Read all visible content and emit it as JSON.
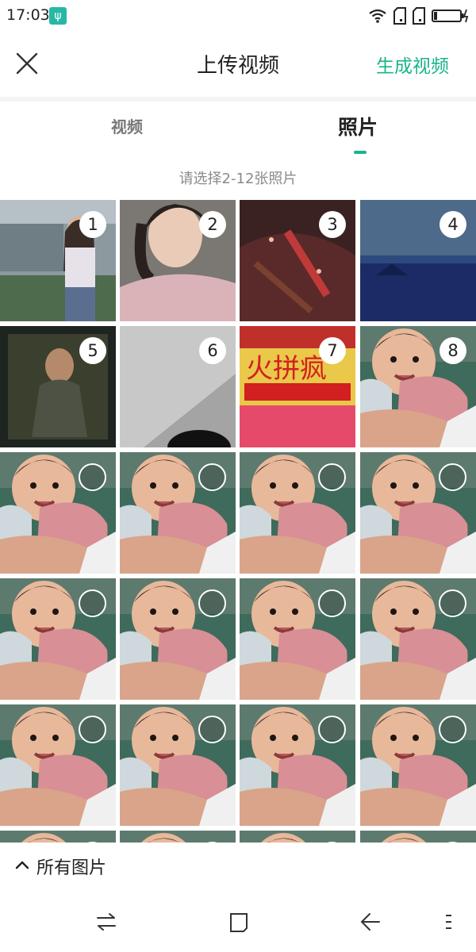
{
  "status_bar": {
    "time": "17:03",
    "usb_icon": "usb-icon",
    "icons": [
      "wifi-icon",
      "sim-1-icon",
      "sim-2-icon",
      "battery-charging-icon"
    ]
  },
  "header": {
    "title": "上传视频",
    "close_icon": "close-icon",
    "action_label": "生成视频"
  },
  "tabs": [
    {
      "label": "视频",
      "active": false
    },
    {
      "label": "照片",
      "active": true
    }
  ],
  "hint": "请选择2-12张照片",
  "selected_numbers": [
    "1",
    "2",
    "3",
    "4",
    "5",
    "6",
    "7",
    "8"
  ],
  "selected_count": 8,
  "grid_columns": 4,
  "album": {
    "label": "所有图片",
    "icon": "chevron-up-icon"
  },
  "colors": {
    "accent": "#1ab488",
    "usb_badge": "#27b8a5",
    "tab_divider": "#f4f4f4"
  },
  "nav": {
    "icons": [
      "switch-icon",
      "home-square-icon",
      "back-icon",
      "menu-icon"
    ]
  }
}
